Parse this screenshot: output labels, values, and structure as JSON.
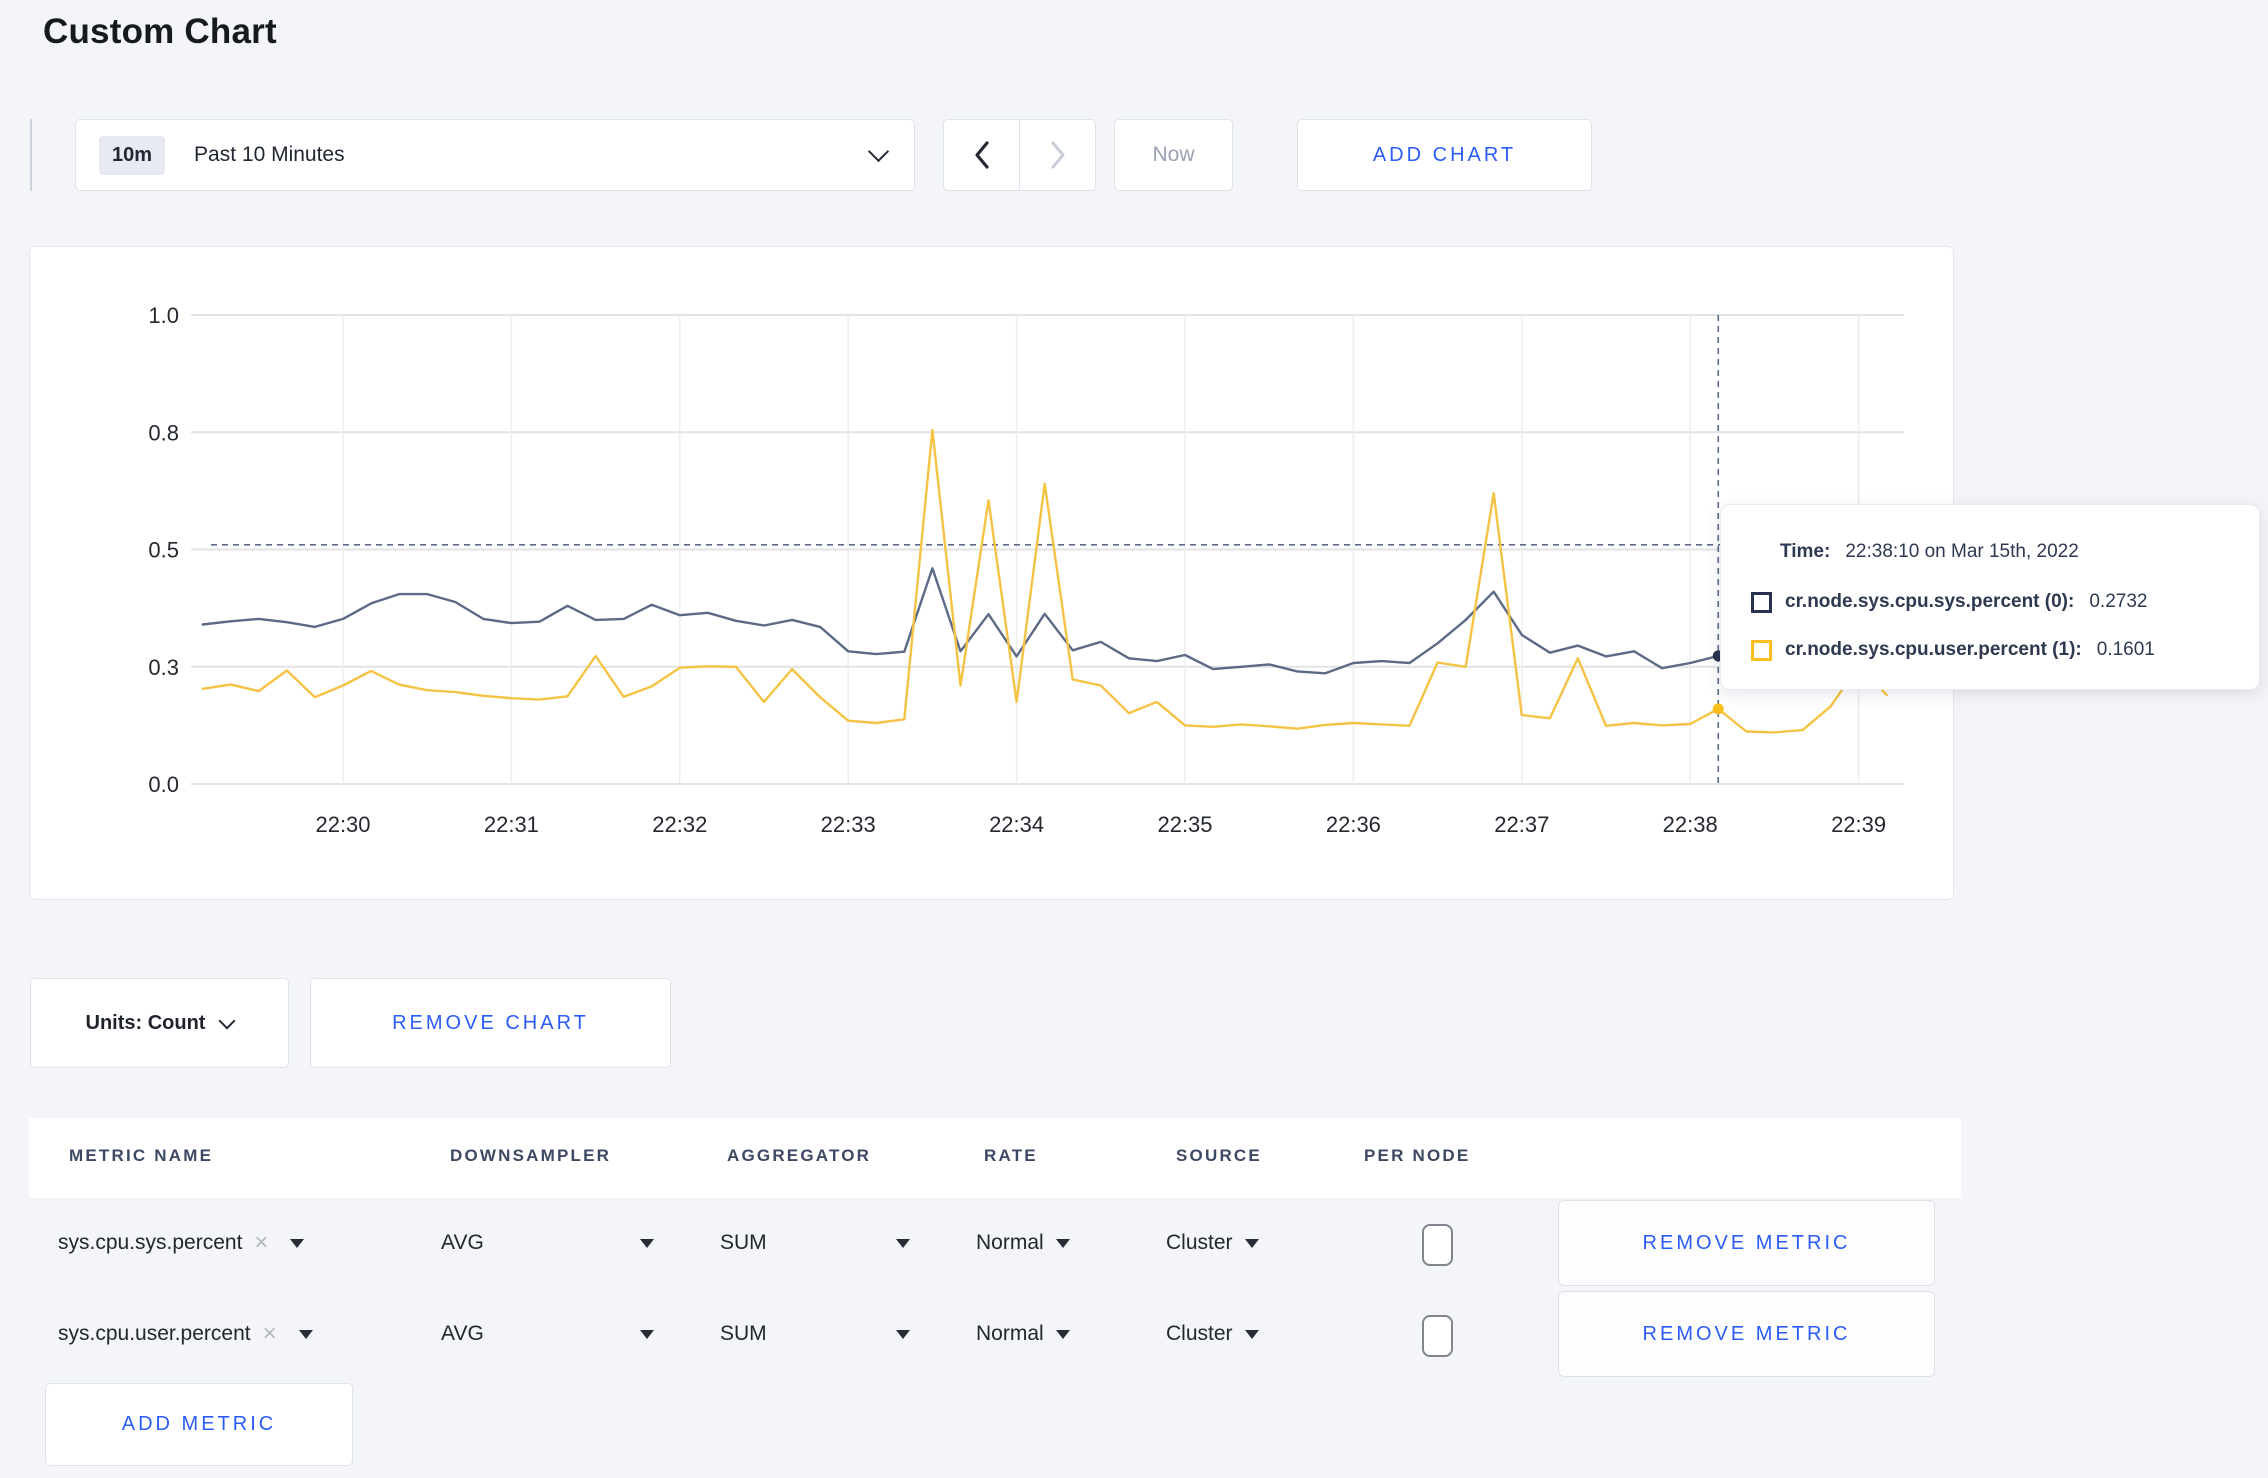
{
  "page_title": "Custom Chart",
  "toolbar": {
    "time_badge": "10m",
    "time_label": "Past 10 Minutes",
    "prev_icon": "chevron-left",
    "next_icon": "chevron-right",
    "now_label": "Now",
    "add_chart_label": "ADD CHART"
  },
  "chart_data": {
    "type": "line",
    "title": "",
    "xlabel": "",
    "ylabel": "",
    "ylim": [
      0,
      1
    ],
    "grid": true,
    "legend_position": "tooltip",
    "y_ticks": [
      {
        "value": 0,
        "label": "0.0"
      },
      {
        "value": 0.25,
        "label": "0.3"
      },
      {
        "value": 0.5,
        "label": "0.5"
      },
      {
        "value": 0.75,
        "label": "0.8"
      },
      {
        "value": 1,
        "label": "1.0"
      }
    ],
    "x_ticks": [
      "22:30",
      "22:31",
      "22:32",
      "22:33",
      "22:34",
      "22:35",
      "22:36",
      "22:37",
      "22:38",
      "22:39"
    ],
    "t0_seconds_after_22_29": 10,
    "t_step_seconds": 10,
    "series": [
      {
        "name": "cr.node.sys.cpu.sys.percent",
        "color": "#5c6a86",
        "swatch": "#26324e",
        "values": [
          0.34,
          0.347,
          0.352,
          0.345,
          0.335,
          0.352,
          0.385,
          0.405,
          0.405,
          0.388,
          0.352,
          0.343,
          0.346,
          0.38,
          0.35,
          0.352,
          0.382,
          0.36,
          0.365,
          0.348,
          0.338,
          0.35,
          0.335,
          0.283,
          0.277,
          0.282,
          0.46,
          0.283,
          0.362,
          0.272,
          0.363,
          0.285,
          0.303,
          0.268,
          0.262,
          0.275,
          0.245,
          0.25,
          0.255,
          0.24,
          0.236,
          0.258,
          0.262,
          0.258,
          0.3,
          0.35,
          0.41,
          0.318,
          0.28,
          0.295,
          0.272,
          0.283,
          0.247,
          0.258,
          0.2732,
          0.262,
          0.256,
          0.283,
          0.262,
          0.272,
          0.278
        ]
      },
      {
        "name": "cr.node.sys.cpu.user.percent",
        "color": "#f5c344",
        "swatch": "#fdbf1e",
        "values": [
          0.203,
          0.212,
          0.198,
          0.242,
          0.185,
          0.21,
          0.241,
          0.212,
          0.2,
          0.196,
          0.188,
          0.183,
          0.18,
          0.187,
          0.273,
          0.186,
          0.208,
          0.248,
          0.251,
          0.25,
          0.175,
          0.245,
          0.185,
          0.135,
          0.13,
          0.138,
          0.755,
          0.21,
          0.605,
          0.175,
          0.64,
          0.223,
          0.21,
          0.151,
          0.175,
          0.125,
          0.122,
          0.127,
          0.123,
          0.118,
          0.126,
          0.13,
          0.127,
          0.124,
          0.259,
          0.25,
          0.62,
          0.147,
          0.14,
          0.268,
          0.124,
          0.13,
          0.125,
          0.128,
          0.1601,
          0.112,
          0.11,
          0.115,
          0.165,
          0.252,
          0.19
        ]
      }
    ],
    "crosshair": {
      "seconds_after_22_29": 550,
      "index": 54,
      "hline_value": 0.51,
      "time": "22:38:10"
    }
  },
  "tooltip": {
    "time_label": "Time:",
    "time_value": "22:38:10 on Mar 15th, 2022",
    "rows": [
      {
        "name": "cr.node.sys.cpu.sys.percent (0):",
        "value": "0.2732"
      },
      {
        "name": "cr.node.sys.cpu.user.percent (1):",
        "value": "0.1601"
      }
    ]
  },
  "chart_controls": {
    "units_label": "Units: Count",
    "remove_chart_label": "REMOVE CHART"
  },
  "metrics_table": {
    "headers": [
      "METRIC NAME",
      "DOWNSAMPLER",
      "AGGREGATOR",
      "RATE",
      "SOURCE",
      "PER NODE"
    ],
    "rows": [
      {
        "metric": "sys.cpu.sys.percent",
        "close_icon": "×",
        "downsampler": "AVG",
        "aggregator": "SUM",
        "rate": "Normal",
        "source": "Cluster",
        "per_node_checked": false,
        "remove_label": "REMOVE METRIC"
      },
      {
        "metric": "sys.cpu.user.percent",
        "close_icon": "×",
        "downsampler": "AVG",
        "aggregator": "SUM",
        "rate": "Normal",
        "source": "Cluster",
        "per_node_checked": false,
        "remove_label": "REMOVE METRIC"
      }
    ],
    "add_metric_label": "ADD METRIC"
  },
  "colors": {
    "accent_blue": "#2c5cf6",
    "page_bg": "#f4f5f9",
    "crosshair": "#5c6b88",
    "grid_h": "#e3e3e7",
    "grid_v": "#ededf0"
  }
}
